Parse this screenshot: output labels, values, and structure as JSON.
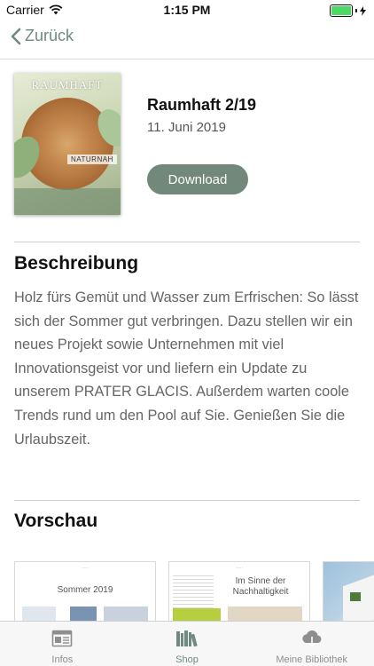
{
  "status_bar": {
    "carrier": "Carrier",
    "time": "1:15 PM",
    "battery_level": 1.0
  },
  "nav": {
    "back_label": "Zurück"
  },
  "issue": {
    "cover_masthead": "RAUMHAFT",
    "cover_badge": "NATURNAH",
    "title": "Raumhaft 2/19",
    "date": "11. Juni 2019",
    "download_label": "Download"
  },
  "description": {
    "heading": "Beschreibung",
    "text": "Holz fürs Gemüt und Wasser zum Erfrischen: So lässt sich der Sommer gut verbringen. Dazu stellen wir ein neues Projekt sowie Unternehmen mit viel Innovationsgeist vor und liefern ein Update zu unserem PRATER GLACIS. Außerdem warten coole Trends rund um den Pool auf Sie. Genießen Sie die Urlaubszeit."
  },
  "preview": {
    "heading": "Vorschau",
    "pages": [
      {
        "title": "Sommer 2019"
      },
      {
        "title": "Im Sinne der Nachhaltigkeit"
      }
    ]
  },
  "tab_bar": {
    "tabs": [
      {
        "label": "Infos",
        "icon": "news-icon",
        "active": false
      },
      {
        "label": "Shop",
        "icon": "books-icon",
        "active": true
      },
      {
        "label": "Meine Bibliothek",
        "icon": "cloud-download-icon",
        "active": false
      }
    ]
  },
  "colors": {
    "accent": "#6f8a7e",
    "button": "#72887a",
    "text_secondary": "#666666"
  }
}
